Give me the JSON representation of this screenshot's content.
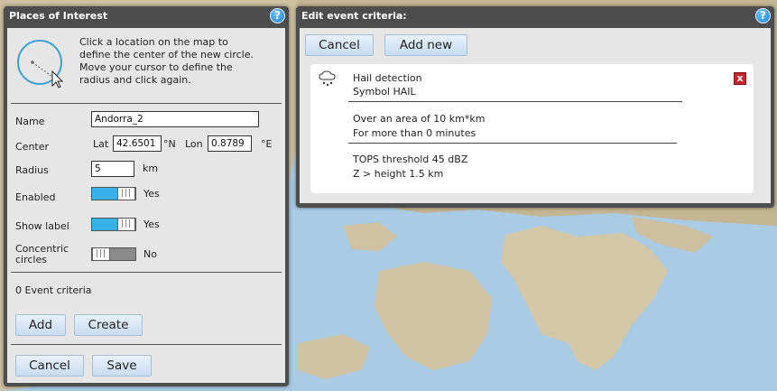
{
  "poi_panel": {
    "title": "Places of Interest",
    "help_glyph": "?",
    "instructions": [
      "Click a location on the map to",
      "define the center of the new circle.",
      "Move your cursor to define the",
      "radius and click again."
    ],
    "name_label": "Name",
    "name_value": "Andorra_2",
    "center_label": "Center",
    "lat_label": "Lat",
    "lat_value": "42.6501",
    "lat_unit": "°N",
    "lon_label": "Lon",
    "lon_value": "0.8789",
    "lon_unit": "°E",
    "radius_label": "Radius",
    "radius_value": "5",
    "radius_unit": "km",
    "enabled_label": "Enabled",
    "enabled_state": "Yes",
    "show_label_label": "Show label",
    "show_label_state": "Yes",
    "concentric_label_1": "Concentric",
    "concentric_label_2": "circles",
    "concentric_state": "No",
    "toggle_glyph": "|||",
    "event_criteria_count": "0 Event criteria",
    "add_button": "Add",
    "create_button": "Create",
    "cancel_button": "Cancel",
    "save_button": "Save"
  },
  "event_panel": {
    "title": "Edit event criteria:",
    "help_glyph": "?",
    "cancel_button": "Cancel",
    "add_new_button": "Add new",
    "close_glyph": "x",
    "criteria": {
      "icon": "hail-cloud-icon",
      "name": "Hail detection",
      "symbol": "Symbol HAIL",
      "area": "Over an area of 10 km*km",
      "duration": "For more than  0 minutes",
      "threshold": "TOPS threshold 45 dBZ",
      "height": "Z > height 1.5 km"
    }
  },
  "colors": {
    "panel_frame": "#4d4d4d",
    "panel_body": "#e6e6e6",
    "toggle_on": "#3ab0e8",
    "toggle_off": "#8a8a8a",
    "map_sea": "#a9cbe4",
    "map_land": "#c9ba9e",
    "close_red": "#c6262e"
  }
}
